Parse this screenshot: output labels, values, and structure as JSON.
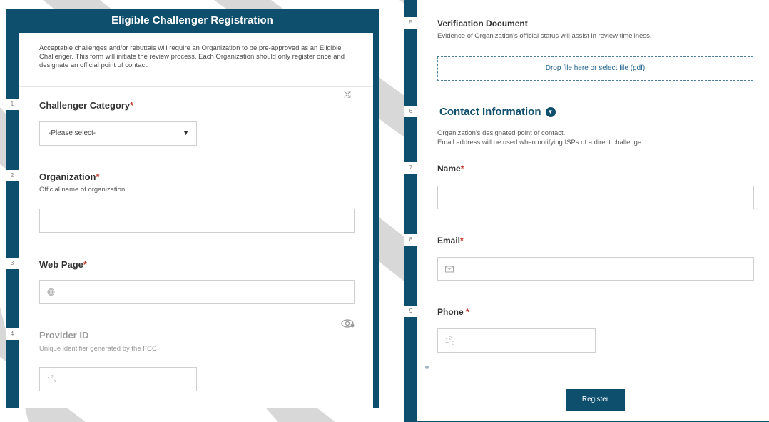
{
  "form": {
    "title": "Eligible Challenger Registration",
    "intro": "Acceptable challenges and/or rebuttals will require an Organization to be pre-approved as an Eligible Challenger. This form will initiate the review process. Each Organization should only register once and designate an official point of contact.",
    "required_marker": "*",
    "colors": {
      "primary": "#0e4f6e",
      "required": "#c0392b"
    }
  },
  "questions": {
    "q1": {
      "num": "1",
      "label": "Challenger Category",
      "value": "-Please select-",
      "caret": "▼",
      "shuffle_icon": "⤮"
    },
    "q2": {
      "num": "2",
      "label": "Organization",
      "desc": "Official name of organization."
    },
    "q3": {
      "num": "3",
      "label": "Web Page",
      "icon": "globe-icon"
    },
    "q4": {
      "num": "4",
      "label": "Provider ID",
      "desc": "Unique identifier generated by the FCC",
      "icon": "numeric-icon",
      "eye_icon": "eye-icon"
    },
    "q5": {
      "num": "5",
      "label": "Verification Document",
      "desc": "Evidence of Organization's official status will assist in review timeliness.",
      "drop_text": "Drop file here or select file (pdf)"
    },
    "q6": {
      "num": "6",
      "label": "Contact Information",
      "desc_line1": "Organization's designated point of contact.",
      "desc_line2": "Email address will be used when notifying ISPs of a direct challenge."
    },
    "q7": {
      "num": "7",
      "label": "Name"
    },
    "q8": {
      "num": "8",
      "label": "Email",
      "icon": "envelope-icon"
    },
    "q9": {
      "num": "9",
      "label": "Phone",
      "icon": "numeric-icon"
    }
  },
  "actions": {
    "submit_label": "Register"
  }
}
